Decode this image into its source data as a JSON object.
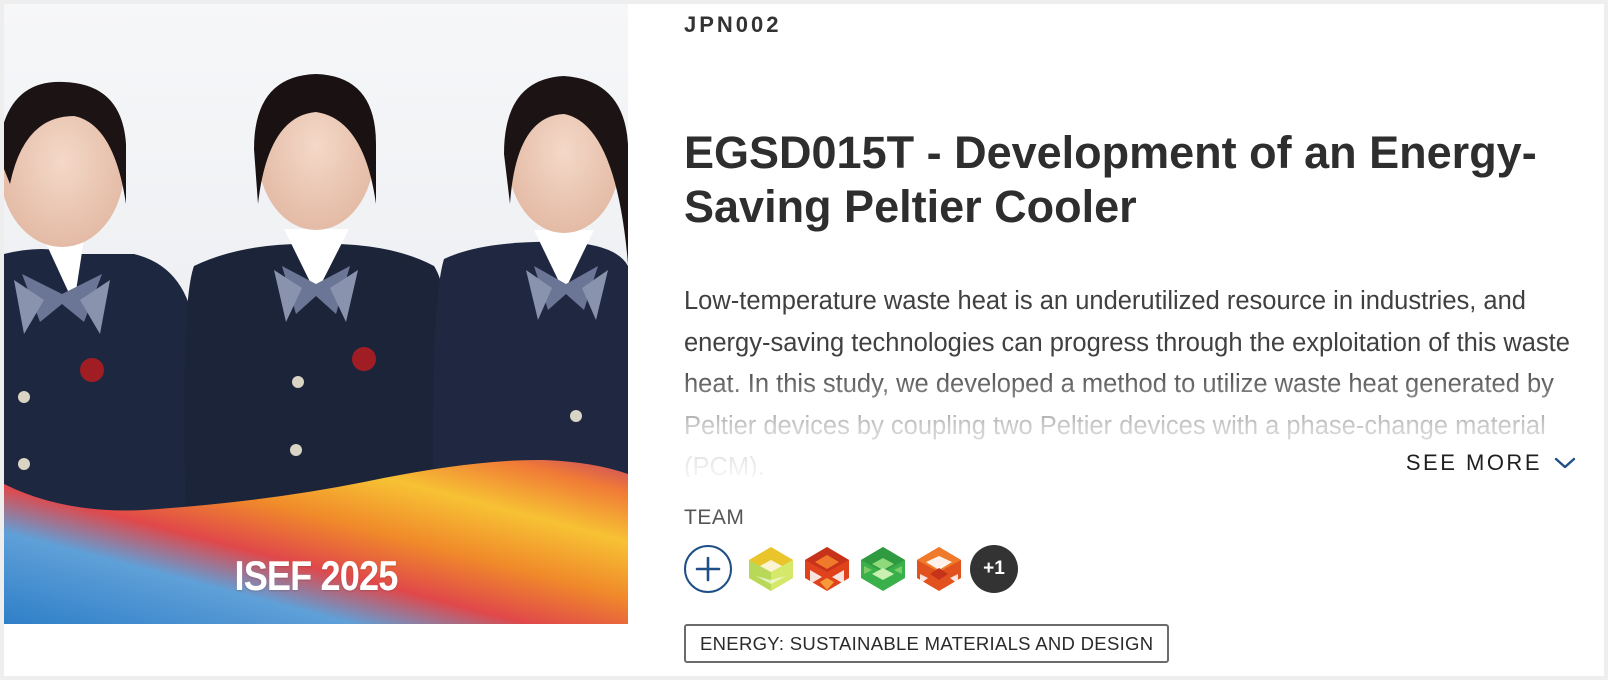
{
  "project": {
    "code": "JPN002",
    "title": "EGSD015T - Development of an Energy-Saving Peltier Cooler",
    "abstract": "Low-temperature waste heat is an underutilized resource in industries, and energy-saving technologies can progress through the exploitation of this waste heat. In this study, we developed a method to utilize waste heat generated by Peltier devices by coupling two Peltier devices with a phase-change material (PCM).",
    "see_more_label": "SEE MORE",
    "category": "ENERGY: SUSTAINABLE MATERIALS AND DESIGN"
  },
  "photo": {
    "banner_text": "ISEF 2025",
    "icon": "team-photo"
  },
  "team": {
    "label": "TEAM",
    "add_icon": "plus-circle-icon",
    "avatars": [
      {
        "icon": "geometric-avatar",
        "color": "#e6c52e"
      },
      {
        "icon": "geometric-avatar",
        "color": "#e0421c"
      },
      {
        "icon": "geometric-avatar",
        "color": "#39b04a"
      },
      {
        "icon": "geometric-avatar",
        "color": "#e2521f"
      }
    ],
    "more_count": "+1"
  },
  "colors": {
    "accent_blue": "#1f4f86",
    "text_dark": "#2e2e2e",
    "badge_dark": "#333333"
  }
}
